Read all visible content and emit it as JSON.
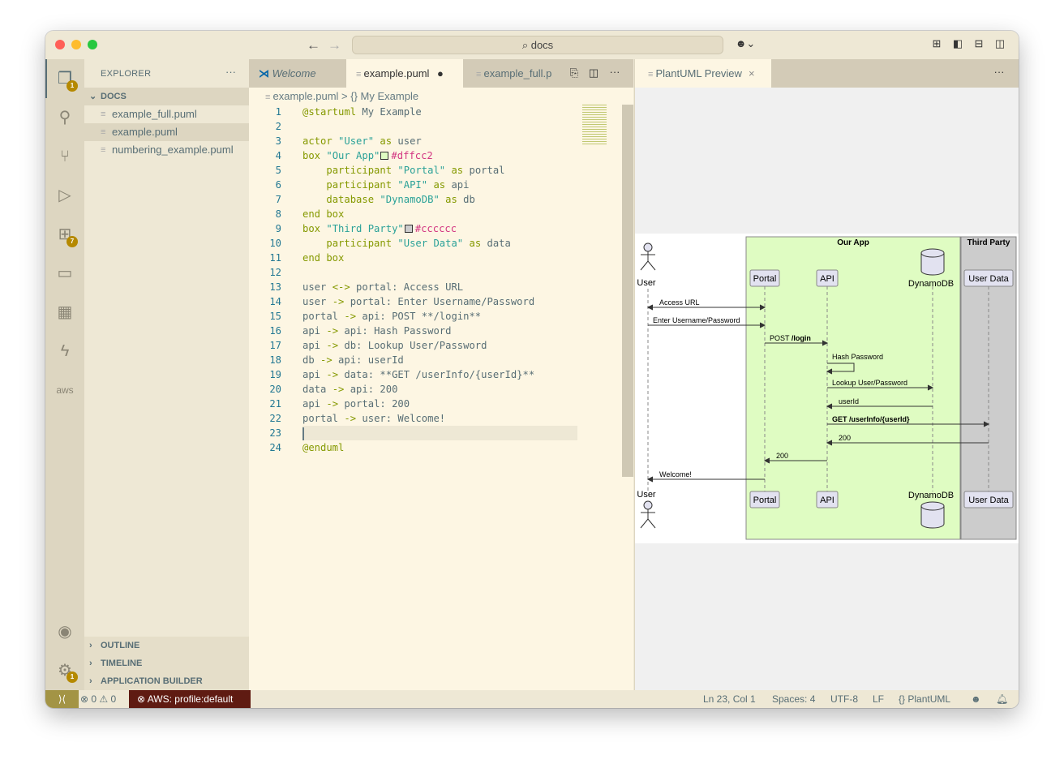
{
  "titlebar": {
    "search": "docs"
  },
  "activity_badges": {
    "explorer": "1",
    "extensions": "7",
    "settings": "1"
  },
  "activity_aws": "aws",
  "sidebar": {
    "title": "EXPLORER",
    "more": "···",
    "folder": "DOCS",
    "files": [
      "example_full.puml",
      "example.puml",
      "numbering_example.puml"
    ],
    "sections": [
      "OUTLINE",
      "TIMELINE",
      "APPLICATION BUILDER"
    ]
  },
  "editor": {
    "tabs": [
      {
        "label": "Welcome"
      },
      {
        "label": "example.puml",
        "dirty": "●"
      },
      {
        "label": "example_full.p"
      }
    ],
    "more": "···",
    "breadcrumb": {
      "file": "example.puml",
      "sep": ">",
      "symbol": "{} My Example"
    },
    "lines": [
      [
        [
          "k",
          "@startuml"
        ],
        [
          "p",
          " My Example"
        ]
      ],
      [],
      [
        [
          "k",
          "actor"
        ],
        [
          "p",
          " "
        ],
        [
          "s",
          "\"User\""
        ],
        [
          "k",
          " as"
        ],
        [
          "p",
          " user"
        ]
      ],
      [
        [
          "k",
          "box"
        ],
        [
          "p",
          " "
        ],
        [
          "s",
          "\"Our App\""
        ],
        [
          "sw",
          "#dffcc2"
        ],
        [
          "c",
          "#dffcc2"
        ]
      ],
      [
        [
          "p",
          "    "
        ],
        [
          "k",
          "participant"
        ],
        [
          "p",
          " "
        ],
        [
          "s",
          "\"Portal\""
        ],
        [
          "k",
          " as"
        ],
        [
          "p",
          " portal"
        ]
      ],
      [
        [
          "p",
          "    "
        ],
        [
          "k",
          "participant"
        ],
        [
          "p",
          " "
        ],
        [
          "s",
          "\"API\""
        ],
        [
          "k",
          " as"
        ],
        [
          "p",
          " api"
        ]
      ],
      [
        [
          "p",
          "    "
        ],
        [
          "k",
          "database"
        ],
        [
          "p",
          " "
        ],
        [
          "s",
          "\"DynamoDB\""
        ],
        [
          "k",
          " as"
        ],
        [
          "p",
          " db"
        ]
      ],
      [
        [
          "k",
          "end box"
        ]
      ],
      [
        [
          "k",
          "box"
        ],
        [
          "p",
          " "
        ],
        [
          "s",
          "\"Third Party\""
        ],
        [
          "sw",
          "#cccccc"
        ],
        [
          "c",
          "#cccccc"
        ]
      ],
      [
        [
          "p",
          "    "
        ],
        [
          "k",
          "participant"
        ],
        [
          "p",
          " "
        ],
        [
          "s",
          "\"User Data\""
        ],
        [
          "k",
          " as"
        ],
        [
          "p",
          " data"
        ]
      ],
      [
        [
          "k",
          "end box"
        ]
      ],
      [],
      [
        [
          "p",
          "user "
        ],
        [
          "k",
          "<->"
        ],
        [
          "p",
          " portal: Access URL"
        ]
      ],
      [
        [
          "p",
          "user "
        ],
        [
          "k",
          "->"
        ],
        [
          "p",
          " portal: Enter Username/Password"
        ]
      ],
      [
        [
          "p",
          "portal "
        ],
        [
          "k",
          "->"
        ],
        [
          "p",
          " api: POST **/login**"
        ]
      ],
      [
        [
          "p",
          "api "
        ],
        [
          "k",
          "->"
        ],
        [
          "p",
          " api: Hash Password"
        ]
      ],
      [
        [
          "p",
          "api "
        ],
        [
          "k",
          "->"
        ],
        [
          "p",
          " db: Lookup User/Password"
        ]
      ],
      [
        [
          "p",
          "db "
        ],
        [
          "k",
          "->"
        ],
        [
          "p",
          " api: userId"
        ]
      ],
      [
        [
          "p",
          "api "
        ],
        [
          "k",
          "->"
        ],
        [
          "p",
          " data: **GET /userInfo/{userId}**"
        ]
      ],
      [
        [
          "p",
          "data "
        ],
        [
          "k",
          "->"
        ],
        [
          "p",
          " api: 200"
        ]
      ],
      [
        [
          "p",
          "api "
        ],
        [
          "k",
          "->"
        ],
        [
          "p",
          " portal: 200"
        ]
      ],
      [
        [
          "p",
          "portal "
        ],
        [
          "k",
          "->"
        ],
        [
          "p",
          " user: Welcome!"
        ]
      ],
      [],
      [
        [
          "k",
          "@enduml"
        ]
      ]
    ]
  },
  "preview": {
    "tab": "PlantUML Preview",
    "close": "×",
    "more": "···",
    "diagram": {
      "boxes": [
        "Our App",
        "Third Party"
      ],
      "participants": [
        "User",
        "Portal",
        "API",
        "DynamoDB",
        "User Data"
      ],
      "messages": [
        "Access URL",
        "Enter Username/Password",
        "POST ",
        "/login",
        "Hash Password",
        "Lookup User/Password",
        "userId",
        "GET /userInfo/{userId}",
        "200",
        "200",
        "Welcome!"
      ]
    }
  },
  "status": {
    "errors": "0",
    "warnings": "0",
    "aws": "AWS: profile:default",
    "position": "Ln 23, Col 1",
    "spaces": "Spaces: 4",
    "encoding": "UTF-8",
    "eol": "LF",
    "language": "PlantUML"
  },
  "colors": {
    "editor_bg": "#fdf6e3",
    "sidebar_bg": "#eee8d5",
    "aws_bg": "#5f1b12",
    "remote_bg": "#a39445",
    "box_app": "#dffcc2",
    "box_third": "#cccccc"
  }
}
